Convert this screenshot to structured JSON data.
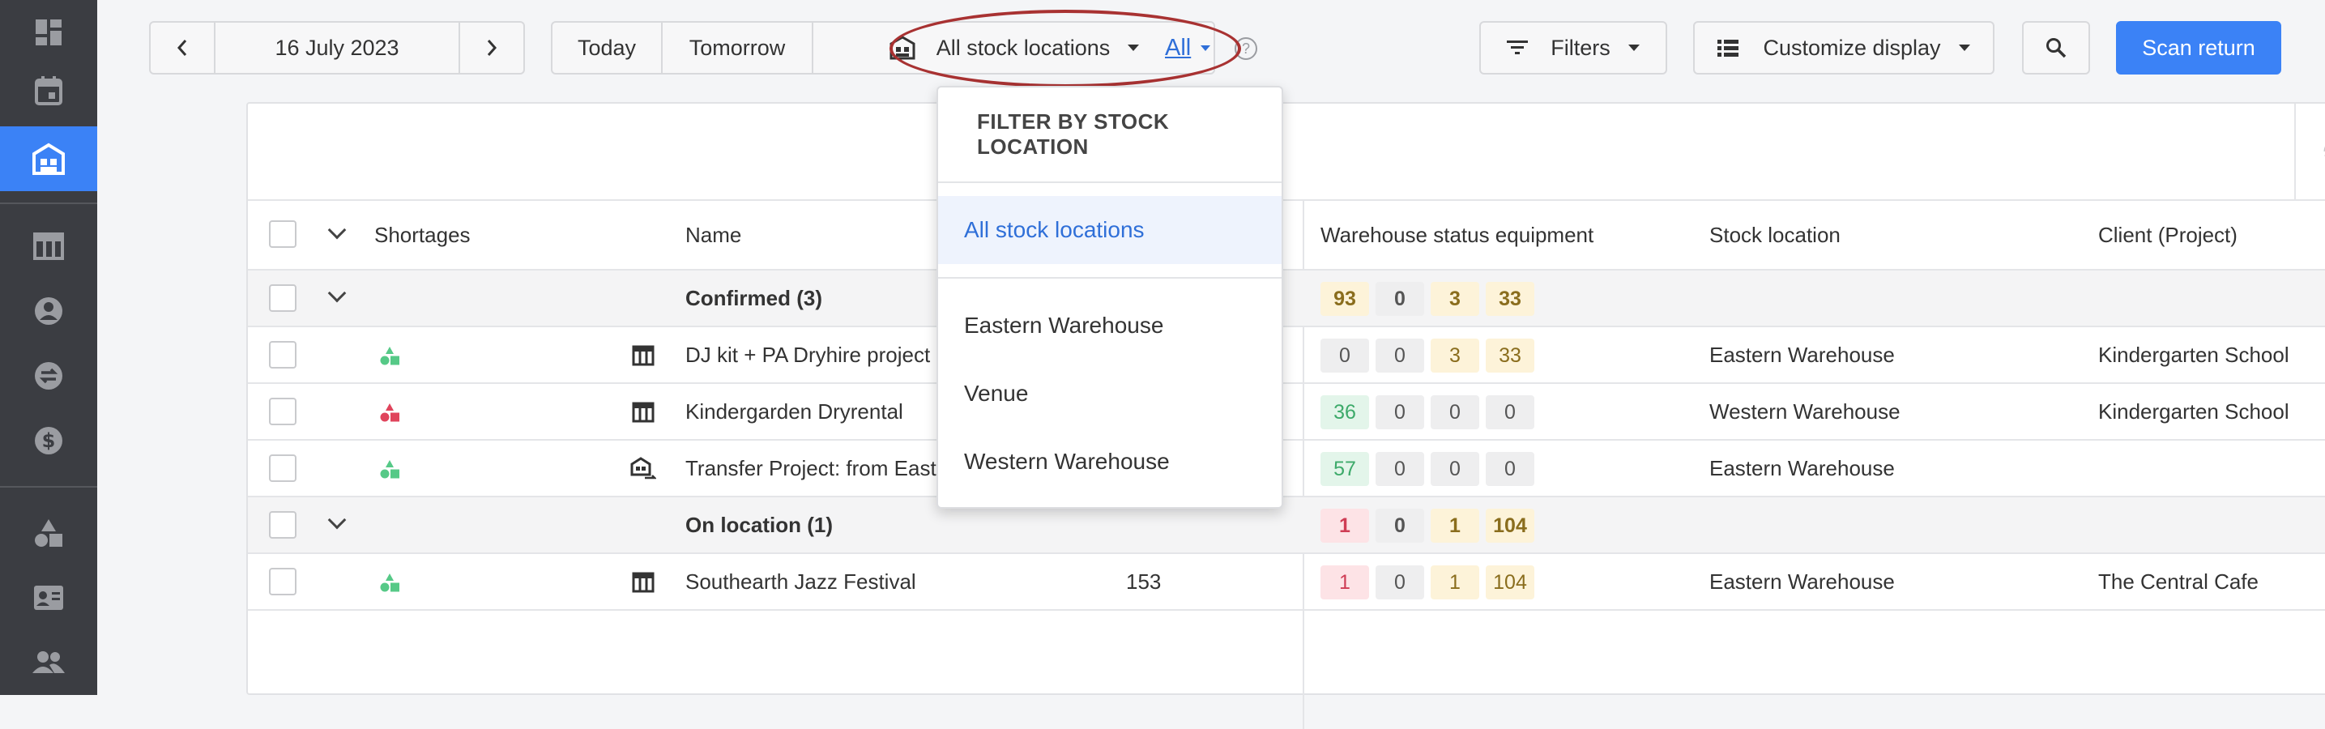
{
  "sidebar": {
    "items": [
      {
        "icon": "dashboard-icon"
      },
      {
        "icon": "calendar-icon"
      },
      {
        "icon": "warehouse-icon",
        "active": true
      },
      {
        "icon": "planning-table-icon"
      },
      {
        "icon": "user-icon"
      },
      {
        "icon": "transfer-icon"
      },
      {
        "icon": "dollar-icon"
      },
      {
        "icon": "shapes-icon"
      },
      {
        "icon": "contact-card-icon"
      },
      {
        "icon": "users-icon"
      }
    ]
  },
  "toolbar": {
    "date": "16 July 2023",
    "today": "Today",
    "tomorrow": "Tomorrow",
    "stock_location": "All stock locations",
    "all_link": "All",
    "filters": "Filters",
    "customize": "Customize display",
    "scan_return": "Scan return"
  },
  "dropdown": {
    "header": "FILTER BY STOCK LOCATION",
    "selected": "All stock locations",
    "options": [
      "Eastern Warehouse",
      "Venue",
      "Western Warehouse"
    ]
  },
  "table": {
    "headers": {
      "shortages": "Shortages",
      "name": "Name",
      "warehouse_status": "Warehouse status equipment",
      "stock_location": "Stock location",
      "client": "Client (Project)"
    },
    "groups": [
      {
        "label": "Confirmed (3)",
        "counts": [
          "93",
          "0",
          "3",
          "33"
        ],
        "rows": [
          {
            "name": "DJ kit + PA Dryhire project",
            "number": "",
            "counts": [
              "0",
              "0",
              "3",
              "33"
            ],
            "location": "Eastern Warehouse",
            "client": "Kindergarten School",
            "shortage": "green"
          },
          {
            "name": "Kindergarden Dryrental",
            "number": "",
            "counts": [
              "36",
              "0",
              "0",
              "0"
            ],
            "location": "Western Warehouse",
            "client": "Kindergarten School",
            "shortage": "red"
          },
          {
            "name": "Transfer Project: from Easter",
            "number": "",
            "counts": [
              "57",
              "0",
              "0",
              "0"
            ],
            "location": "Eastern Warehouse",
            "client": "",
            "shortage": "green"
          }
        ]
      },
      {
        "label": "On location (1)",
        "counts": [
          "1",
          "0",
          "1",
          "104"
        ],
        "rows": [
          {
            "name": "Southearth Jazz Festival",
            "number": "153",
            "counts": [
              "1",
              "0",
              "1",
              "104"
            ],
            "location": "Eastern Warehouse",
            "client": "The Central Cafe",
            "shortage": "green"
          }
        ]
      }
    ]
  },
  "colors": {
    "accent": "#3b82f6",
    "sidebar": "#3b3d42",
    "highlight_ellipse": "#a83232"
  }
}
